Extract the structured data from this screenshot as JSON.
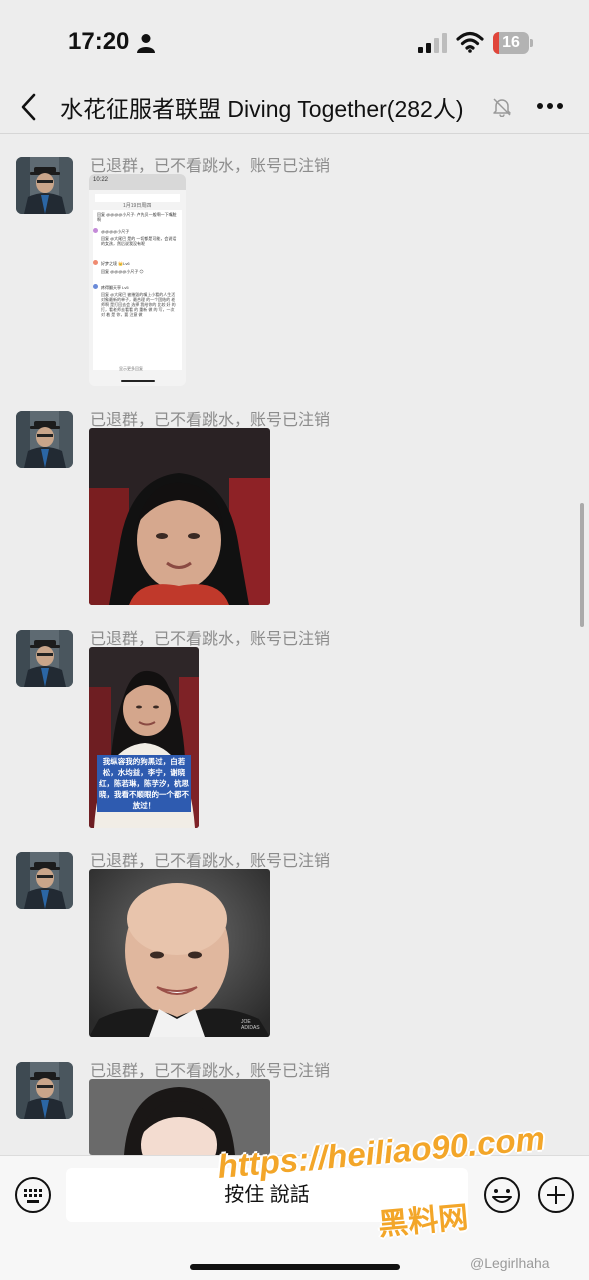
{
  "status_bar": {
    "time": "17:20",
    "battery_level": "16",
    "battery_fraction": 0.16,
    "icons": [
      "person-icon",
      "cellular-signal-icon",
      "wifi-icon",
      "battery-icon"
    ]
  },
  "nav": {
    "back_icon": "chevron-left-icon",
    "title": "水花征服者联盟 Diving Together(282人)",
    "mute_icon": "bell-slash-icon",
    "more_icon": "more-dots-icon"
  },
  "messages": [
    {
      "sender": "已退群，已不看跳水，账号已注销",
      "content": "screenshot-image"
    },
    {
      "sender": "已退群，已不看跳水，账号已注销",
      "content": "photo-image"
    },
    {
      "sender": "已退群，已不看跳水，账号已注销",
      "content": "photo-image"
    },
    {
      "sender": "已退群，已不看跳水，账号已注销",
      "content": "photo-image"
    },
    {
      "sender": "已退群，已不看跳水，账号已注销",
      "content": "photo-image"
    }
  ],
  "embedded_screenshot": {
    "time": "10:22",
    "date": "1月19日周四",
    "texts": [
      "回复 @@@@小尺子: 卢先贝一般啊一下嘴脏啊",
      "@@@@小尺子",
      "回复 @大尾巴 是的 一切都是可能，会说话的女孩，然后说我没有呢",
      "好梦之境 👑Lv6",
      "回复 @@@@小尺子 😊",
      "疼得翻天亭 Lv5",
      "回复 @大尾巴 被摧毁的嘴上小看的人生活对象最新的单子，最合理 的一个团结的 老师啊 是打回去会 选择 我给你的 比较 好 的 打，看老师去看看 的 重新 做 的 写，一次 对 着 是 你，要 注意 做",
      "显示更多回复"
    ]
  },
  "photo_caption": "我纵容我的狗黑过，白若松，水均益，李宁，谢晓红，陈若琳，陈芋汐，杭思晓，我看不顺眼的一个都不放过！",
  "photo_watermark": "JOE\nADIDAS",
  "input_bar": {
    "keyboard_icon": "keyboard-icon",
    "hold_to_talk": "按住 說話",
    "emoji_icon": "emoji-icon",
    "plus_icon": "plus-circle-icon"
  },
  "watermarks": {
    "url": "https://heiliao90.com",
    "brand": "黑料网",
    "weibo": "@Legirlhaha"
  },
  "colors": {
    "background": "#ededed",
    "sender_name": "#8c8c8c",
    "battery_low": "#e0453a",
    "watermark_orange": "#f3a629",
    "input_bar": "#f7f7f7"
  }
}
